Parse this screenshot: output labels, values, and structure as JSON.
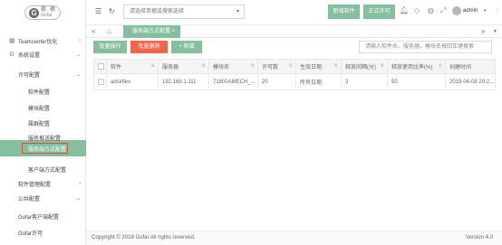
{
  "logo": {
    "mark": "G",
    "cn": "歌 德",
    "en": "Gofar"
  },
  "header": {
    "search_placeholder": "请选择单据或搜索选择",
    "new_software": "新增软件",
    "formal_license": "正式许可",
    "user": "admin"
  },
  "sidebar": {
    "items": [
      {
        "label": "Teamcenter优化",
        "level": "top",
        "icon": "teamcenter-icon",
        "expand": "›"
      },
      {
        "label": "系统设置",
        "level": "top",
        "icon": "gear-icon",
        "expand": "⌄"
      },
      {
        "label": "许可配置",
        "level": "sub",
        "expand": "⌄"
      },
      {
        "label": "软件配置",
        "level": "leaf"
      },
      {
        "label": "模块配置",
        "level": "leaf"
      },
      {
        "label": "属群配置",
        "level": "leaf"
      },
      {
        "label": "服务推送配置",
        "level": "leaf"
      },
      {
        "label": "服务端方式配置",
        "level": "leaf",
        "active": true
      },
      {
        "label": "客户端方式配置",
        "level": "leaf"
      },
      {
        "label": "软件管理配置",
        "level": "sub",
        "expand": "›"
      },
      {
        "label": "公共配置",
        "level": "sub",
        "expand": "⌄"
      },
      {
        "label": "Gofar客户端配置",
        "level": "sub"
      },
      {
        "label": "Gofar许可",
        "level": "sub"
      }
    ]
  },
  "tabs": {
    "active_label": "服务端方式配置",
    "close": "×"
  },
  "toolbar": {
    "batch_op": "批量操作",
    "batch_delete": "批量删除",
    "add": "+ 新增",
    "search_placeholder": "请输入软件名、服务器、模块名按回车键搜索"
  },
  "table": {
    "headers": [
      "软件",
      "服务器",
      "模块名",
      "许可数",
      "生效日期",
      "释放间隔(分)",
      "释放使用比率(%)",
      "创建时间"
    ],
    "rows": [
      [
        "adskflex",
        "192.168.1.111",
        "71800AMECH_...",
        "20",
        "所有日期",
        "3",
        "50",
        "2019-04-08 20:2..."
      ]
    ]
  },
  "footer": {
    "copyright": "Copyright © 2018 Gofar All rights reserved.",
    "version": "Version 4.0"
  },
  "colors": {
    "accent_green": "#85bf9f",
    "danger_red": "#f2654b",
    "highlight_border": "#c9573a"
  }
}
